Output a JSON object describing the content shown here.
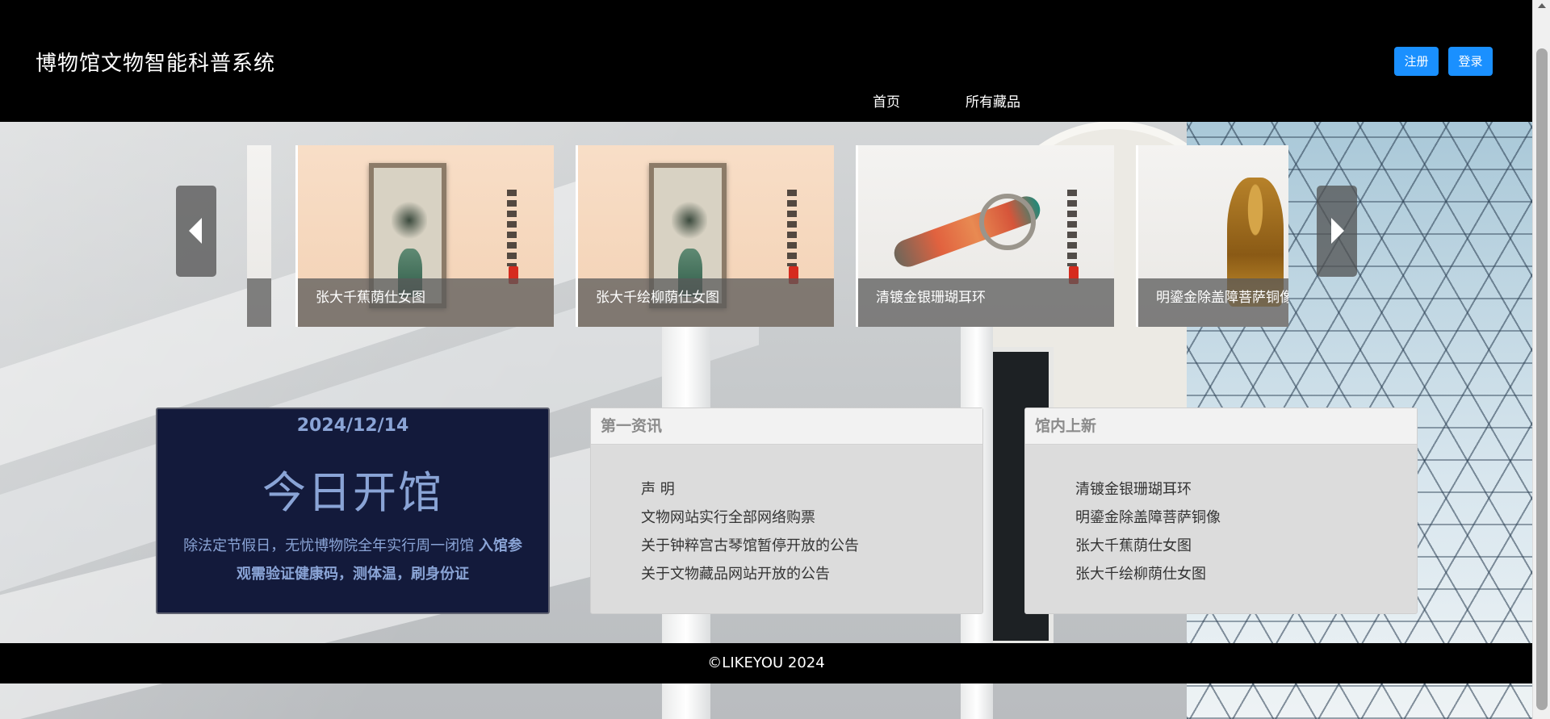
{
  "header": {
    "site_title": "博物馆文物智能科普系统",
    "register_label": "注册",
    "login_label": "登录",
    "nav": {
      "home": "首页",
      "all_collections": "所有藏品"
    }
  },
  "carousel": {
    "slides": [
      {
        "caption": "张大千蕉荫仕女图"
      },
      {
        "caption": "张大千绘柳荫仕女图"
      },
      {
        "caption": "清镀金银珊瑚耳环"
      },
      {
        "caption": "明鎏金除盖障菩萨铜像"
      }
    ]
  },
  "today": {
    "date": "2024/12/14",
    "status": "今日开馆",
    "note_plain": "除法定节假日，无忧博物院全年实行周一闭馆 ",
    "note_bold": "入馆参观需验证健康码，测体温，刷身份证"
  },
  "news": {
    "title": "第一资讯",
    "items": [
      "声 明",
      "文物网站实行全部网络购票",
      "关于钟粹宫古琴馆暂停开放的公告",
      "关于文物藏品网站开放的公告"
    ]
  },
  "new_items": {
    "title": "馆内上新",
    "items": [
      "清镀金银珊瑚耳环",
      "明鎏金除盖障菩萨铜像",
      "张大千蕉荫仕女图",
      "张大千绘柳荫仕女图"
    ]
  },
  "footer": {
    "copyright": "©LIKEYOU 2024"
  },
  "colors": {
    "primary_button": "#1a90ff",
    "today_panel_bg": "#131a3b",
    "today_text": "#8aa4d6"
  }
}
